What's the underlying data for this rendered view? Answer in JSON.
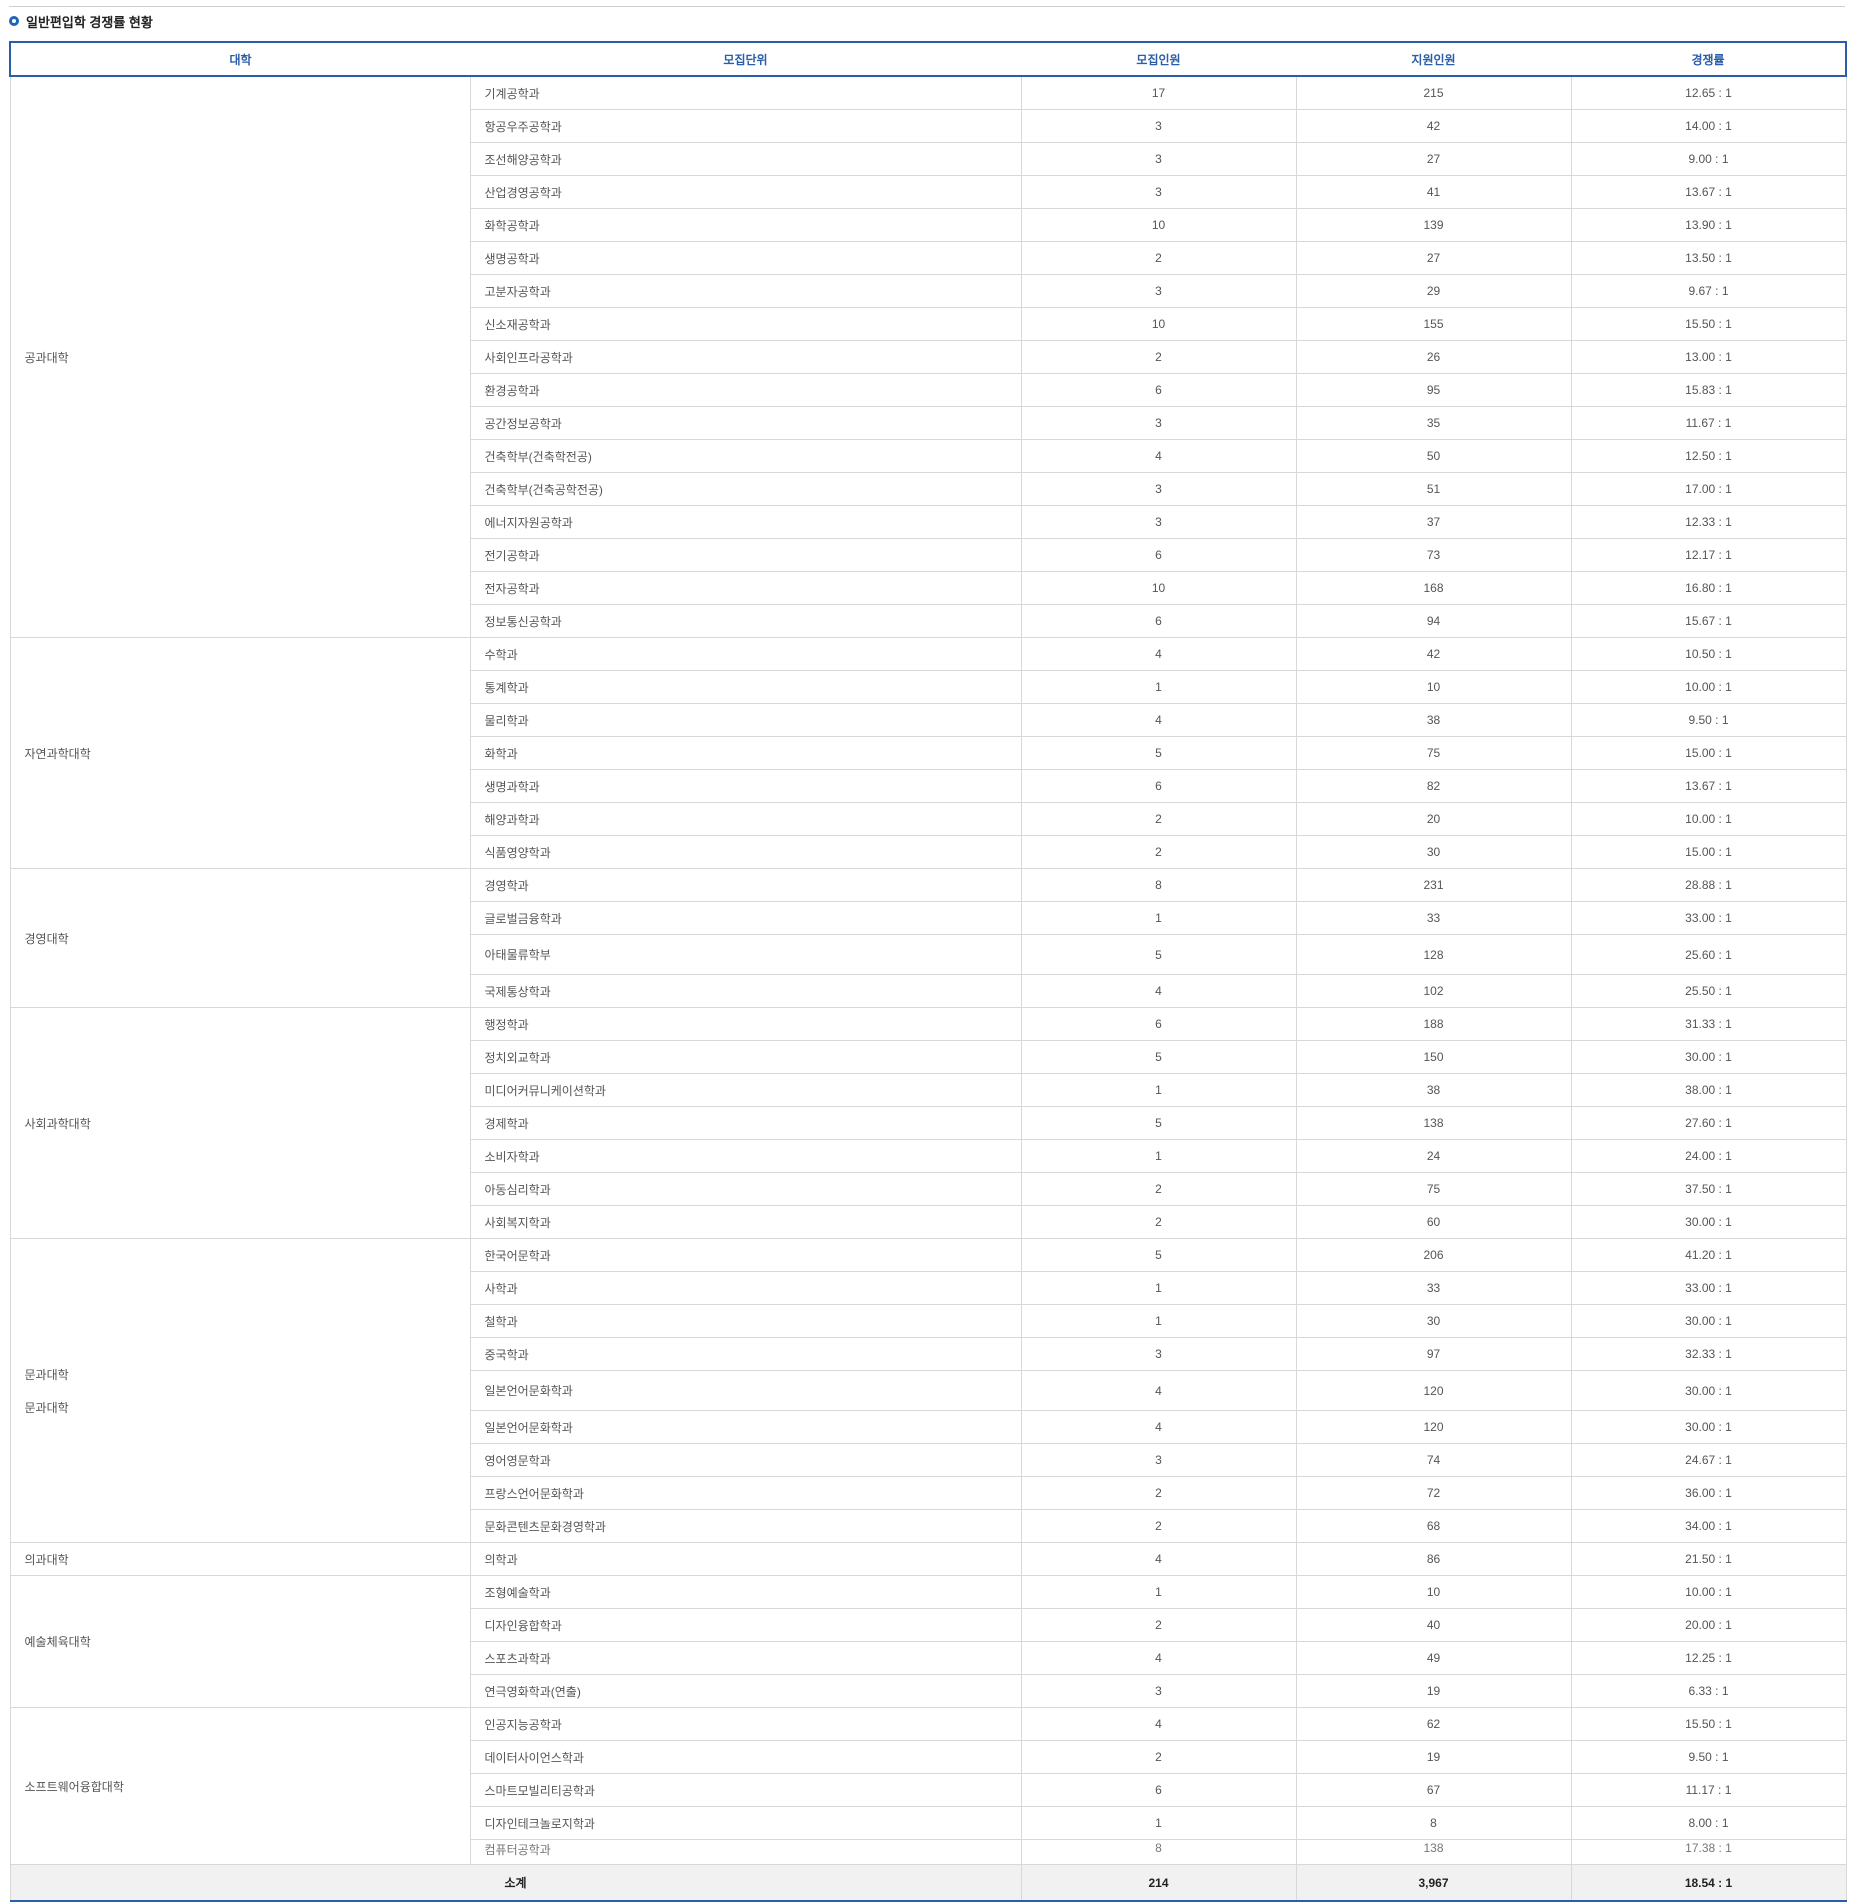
{
  "title": "일반편입학 경쟁률 현황",
  "columns": [
    "대학",
    "모집단위",
    "모집인원",
    "지원인원",
    "경쟁률"
  ],
  "groups": [
    {
      "college": "공과대학",
      "rows": [
        [
          "기계공학과",
          "17",
          "215",
          "12.65 : 1"
        ],
        [
          "항공우주공학과",
          "3",
          "42",
          "14.00 : 1"
        ],
        [
          "조선해양공학과",
          "3",
          "27",
          "9.00 : 1"
        ],
        [
          "산업경영공학과",
          "3",
          "41",
          "13.67 : 1"
        ],
        [
          "화학공학과",
          "10",
          "139",
          "13.90 : 1"
        ],
        [
          "생명공학과",
          "2",
          "27",
          "13.50 : 1"
        ],
        [
          "고분자공학과",
          "3",
          "29",
          "9.67 : 1"
        ],
        [
          "신소재공학과",
          "10",
          "155",
          "15.50 : 1"
        ],
        [
          "사회인프라공학과",
          "2",
          "26",
          "13.00 : 1"
        ],
        [
          "환경공학과",
          "6",
          "95",
          "15.83 : 1"
        ],
        [
          "공간정보공학과",
          "3",
          "35",
          "11.67 : 1"
        ],
        [
          "건축학부(건축학전공)",
          "4",
          "50",
          "12.50 : 1"
        ],
        [
          "건축학부(건축공학전공)",
          "3",
          "51",
          "17.00 : 1"
        ],
        [
          "에너지자원공학과",
          "3",
          "37",
          "12.33 : 1"
        ],
        [
          "전기공학과",
          "6",
          "73",
          "12.17 : 1"
        ],
        [
          "전자공학과",
          "10",
          "168",
          "16.80 : 1"
        ],
        [
          "정보통신공학과",
          "6",
          "94",
          "15.67 : 1"
        ]
      ]
    },
    {
      "college": "자연과학대학",
      "rows": [
        [
          "수학과",
          "4",
          "42",
          "10.50 : 1"
        ],
        [
          "통계학과",
          "1",
          "10",
          "10.00 : 1"
        ],
        [
          "물리학과",
          "4",
          "38",
          "9.50 : 1"
        ],
        [
          "화학과",
          "5",
          "75",
          "15.00 : 1"
        ],
        [
          "생명과학과",
          "6",
          "82",
          "13.67 : 1"
        ],
        [
          "해양과학과",
          "2",
          "20",
          "10.00 : 1"
        ],
        [
          "식품영양학과",
          "2",
          "30",
          "15.00 : 1"
        ]
      ]
    },
    {
      "college": "경영대학",
      "rows": [
        [
          "경영학과",
          "8",
          "231",
          "28.88 : 1"
        ],
        [
          "글로벌금융학과",
          "1",
          "33",
          "33.00 : 1"
        ],
        [
          "아태물류학부",
          "5",
          "128",
          "25.60 : 1"
        ],
        [
          "국제통상학과",
          "4",
          "102",
          "25.50 : 1"
        ]
      ]
    },
    {
      "college": "사회과학대학",
      "rows": [
        [
          "행정학과",
          "6",
          "188",
          "31.33 : 1"
        ],
        [
          "정치외교학과",
          "5",
          "150",
          "30.00 : 1"
        ],
        [
          "미디어커뮤니케이션학과",
          "1",
          "38",
          "38.00 : 1"
        ],
        [
          "경제학과",
          "5",
          "138",
          "27.60 : 1"
        ],
        [
          "소비자학과",
          "1",
          "24",
          "24.00 : 1"
        ],
        [
          "아동심리학과",
          "2",
          "75",
          "37.50 : 1"
        ],
        [
          "사회복지학과",
          "2",
          "60",
          "30.00 : 1"
        ]
      ]
    },
    {
      "college": "문과대학",
      "college_repeat": "문과대학",
      "rows": [
        [
          "한국어문학과",
          "5",
          "206",
          "41.20 : 1"
        ],
        [
          "사학과",
          "1",
          "33",
          "33.00 : 1"
        ],
        [
          "철학과",
          "1",
          "30",
          "30.00 : 1"
        ],
        [
          "중국학과",
          "3",
          "97",
          "32.33 : 1"
        ],
        [
          "일본언어문화학과",
          "4",
          "120",
          "30.00 : 1"
        ],
        [
          "일본언어문화학과",
          "4",
          "120",
          "30.00 : 1"
        ],
        [
          "영어영문학과",
          "3",
          "74",
          "24.67 : 1"
        ],
        [
          "프랑스언어문화학과",
          "2",
          "72",
          "36.00 : 1"
        ],
        [
          "문화콘텐츠문화경영학과",
          "2",
          "68",
          "34.00 : 1"
        ]
      ]
    },
    {
      "college": "의과대학",
      "rows": [
        [
          "의학과",
          "4",
          "86",
          "21.50 : 1"
        ]
      ]
    },
    {
      "college": "예술체육대학",
      "rows": [
        [
          "조형예술학과",
          "1",
          "10",
          "10.00 : 1"
        ],
        [
          "디자인융합학과",
          "2",
          "40",
          "20.00 : 1"
        ],
        [
          "스포츠과학과",
          "4",
          "49",
          "12.25 : 1"
        ],
        [
          "연극영화학과(연출)",
          "3",
          "19",
          "6.33 : 1"
        ]
      ]
    },
    {
      "college": "소프트웨어융합대학",
      "rows": [
        [
          "인공지능공학과",
          "4",
          "62",
          "15.50 : 1"
        ],
        [
          "데이터사이언스학과",
          "2",
          "19",
          "9.50 : 1"
        ],
        [
          "스마트모빌리티공학과",
          "6",
          "67",
          "11.17 : 1"
        ],
        [
          "디자인테크놀로지학과",
          "1",
          "8",
          "8.00 : 1"
        ],
        [
          "컴퓨터공학과",
          "8",
          "138",
          "17.38 : 1"
        ]
      ]
    }
  ],
  "total": {
    "label": "소계",
    "recruit": "214",
    "applicants": "3,967",
    "rate": "18.54 : 1"
  }
}
